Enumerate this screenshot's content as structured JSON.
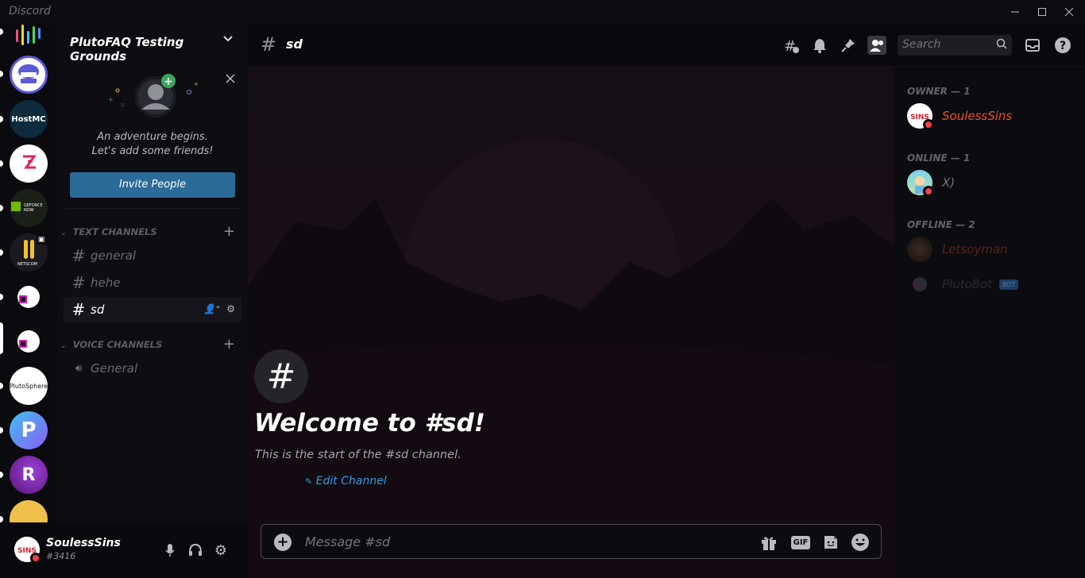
{
  "window": {
    "app_name": "Discord",
    "controls": [
      "minimize-icon",
      "maximize-icon",
      "close-icon"
    ]
  },
  "servers": [
    {
      "name": "sound-bars",
      "label": ""
    },
    {
      "name": "cloud-server",
      "label": ""
    },
    {
      "name": "hostmc",
      "label": "HostMC"
    },
    {
      "name": "red-logo",
      "label": ""
    },
    {
      "name": "geforce-now",
      "label": "GEFORCE NOW"
    },
    {
      "name": "netscom",
      "label": "NETSCOM"
    },
    {
      "name": "pluto-1",
      "label": ""
    },
    {
      "name": "pluto-2",
      "label": ""
    },
    {
      "name": "plutosphere",
      "label": "PlutoSphere"
    },
    {
      "name": "p-blue",
      "label": ""
    },
    {
      "name": "r-purple",
      "label": ""
    },
    {
      "name": "yellow",
      "label": ""
    }
  ],
  "guild": {
    "name": "PlutoFAQ Testing Grounds"
  },
  "invite": {
    "line1": "An adventure begins.",
    "line2": "Let's add some friends!",
    "button": "Invite People"
  },
  "categories": {
    "text": "TEXT CHANNELS",
    "voice": "VOICE CHANNELS"
  },
  "channels": [
    {
      "name": "general",
      "type": "text"
    },
    {
      "name": "hehe",
      "type": "text-locked"
    },
    {
      "name": "sd",
      "type": "text",
      "active": true
    }
  ],
  "voice_channels": [
    {
      "name": "General"
    }
  ],
  "user": {
    "name": "SoulessSins",
    "tag": "#3416"
  },
  "header": {
    "channel": "sd",
    "search_placeholder": "Search"
  },
  "welcome": {
    "title": "Welcome to #sd!",
    "subtitle": "This is the start of the #sd channel.",
    "edit": "Edit Channel"
  },
  "composer": {
    "placeholder": "Message #sd",
    "gif": "GIF"
  },
  "members": {
    "owner_heading": "OWNER — 1",
    "online_heading": "ONLINE — 1",
    "offline_heading": "OFFLINE — 2",
    "owner": [
      {
        "name": "SoulessSins",
        "color": "#e8542c"
      }
    ],
    "online": [
      {
        "name": "X)",
        "color": "#72767d"
      }
    ],
    "offline": [
      {
        "name": "Letsoyman",
        "color": "#5a2418"
      },
      {
        "name": "PlutoBot",
        "color": "#2a2b33",
        "badge": "BOT"
      }
    ]
  },
  "colors": {
    "accent": "#2b6b98",
    "link": "#2f9be6",
    "dnd": "#ed4245"
  }
}
